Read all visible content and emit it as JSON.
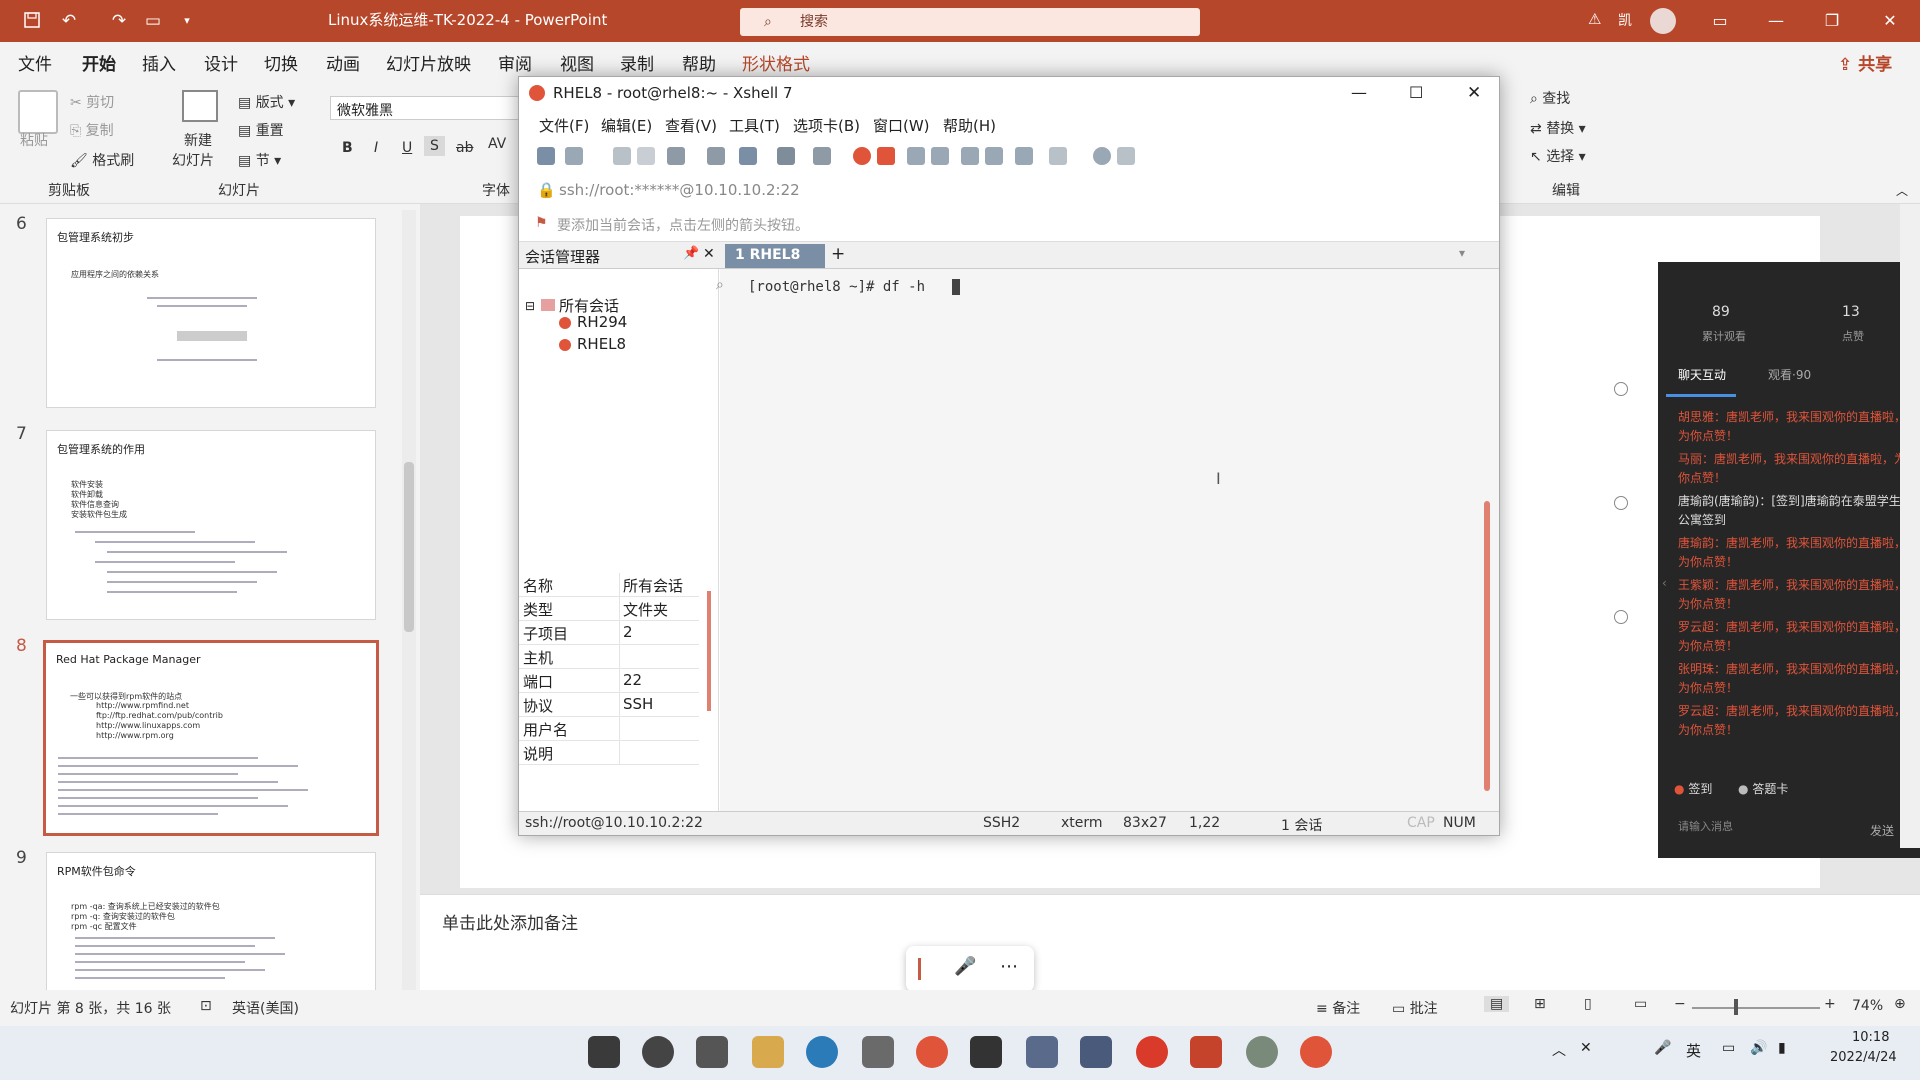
{
  "titlebar": {
    "doc_title": "Linux系统运维-TK-2022-4  -  PowerPoint",
    "search_placeholder": "搜索",
    "user_short": "凯"
  },
  "menu": [
    "文件",
    "开始",
    "插入",
    "设计",
    "切换",
    "动画",
    "幻灯片放映",
    "审阅",
    "视图",
    "录制",
    "帮助",
    "形状格式"
  ],
  "share_label": "共享",
  "ribbon": {
    "paste": "粘贴",
    "cut": "剪切",
    "copy": "复制",
    "format_painter": "格式刷",
    "clipboard": "剪贴板",
    "new_slide_1": "新建",
    "new_slide_2": "幻灯片",
    "layout": "版式",
    "reset": "重置",
    "section": "节",
    "slides_group": "幻灯片",
    "font_name": "微软雅黑",
    "font_group": "字体",
    "bold": "B",
    "italic": "I",
    "underline": "U",
    "shadow": "S",
    "strike": "ab",
    "spacing": "AV",
    "find": "查找",
    "replace": "替换",
    "select": "选择",
    "edit_group": "编辑"
  },
  "slides": [
    {
      "num": "6",
      "title": "包管理系统初步",
      "sub": [
        "应用程序之间的依赖关系"
      ]
    },
    {
      "num": "7",
      "title": "包管理系统的作用",
      "sub": [
        "软件安装",
        "软件卸载",
        "软件信息查询",
        "安装软件包生成"
      ]
    },
    {
      "num": "8",
      "title": "Red Hat Package Manager",
      "sub": [
        "一些可以获得到rpm软件的站点",
        "http://www.rpmfind.net",
        "ftp://ftp.redhat.com/pub/contrib",
        "http://www.linuxapps.com",
        "http://www.rpm.org"
      ]
    },
    {
      "num": "9",
      "title": "RPM软件包命令",
      "sub": [
        "rpm -qa: 查询系统上已经安装过的软件包",
        "rpm -q: 查询安装过的软件包",
        "rpm -qc 配置文件"
      ]
    }
  ],
  "notes_placeholder": "单击此处添加备注",
  "statusbar": {
    "slide_info": "幻灯片 第 8 张，共 16 张",
    "language": "英语(美国)",
    "notes": "备注",
    "comments": "批注",
    "zoom": "74%"
  },
  "xshell": {
    "title": "RHEL8 - root@rhel8:~ - Xshell 7",
    "menu": [
      "文件(F)",
      "编辑(E)",
      "查看(V)",
      "工具(T)",
      "选项卡(B)",
      "窗口(W)",
      "帮助(H)"
    ],
    "address": "ssh://root:******@10.10.10.2:22",
    "hint": "要添加当前会话，点击左侧的箭头按钮。",
    "session_manager": "会话管理器",
    "tab_label": "1 RHEL8",
    "tree_root": "所有会话",
    "tree_items": [
      "RH294",
      "RHEL8"
    ],
    "terminal_line": "[root@rhel8 ~]# df -h",
    "props": [
      {
        "k": "名称",
        "v": "所有会话"
      },
      {
        "k": "类型",
        "v": "文件夹"
      },
      {
        "k": "子项目",
        "v": "2"
      },
      {
        "k": "主机",
        "v": ""
      },
      {
        "k": "端口",
        "v": "22"
      },
      {
        "k": "协议",
        "v": "SSH"
      },
      {
        "k": "用户名",
        "v": ""
      },
      {
        "k": "说明",
        "v": ""
      }
    ],
    "status": {
      "conn": "ssh://root@10.10.10.2:22",
      "proto": "SSH2",
      "term": "xterm",
      "size": "83x27",
      "pos": "1,22",
      "sessions": "1 会话",
      "cap": "CAP",
      "num": "NUM"
    }
  },
  "live": {
    "stat1_value": "89",
    "stat1_label": "累计观看",
    "stat2_value": "13",
    "stat2_label": "点赞",
    "tab_chat": "聊天互动",
    "tab_watch": "观看·90",
    "messages": [
      "胡思雅：唐凯老师，我来围观你的直播啦，为你点赞！",
      "马丽：唐凯老师，我来围观你的直播啦，为你点赞！",
      "唐瑜韵(唐瑜韵)：[签到]唐瑜韵在泰盟学生公寓签到",
      "唐瑜韵：唐凯老师，我来围观你的直播啦，为你点赞！",
      "王紫颖：唐凯老师，我来围观你的直播啦，为你点赞！",
      "罗云超：唐凯老师，我来围观你的直播啦，为你点赞！",
      "张明珠：唐凯老师，我来围观你的直播啦，为你点赞！",
      "罗云超：唐凯老师，我来围观你的直播啦，为你点赞！"
    ],
    "checkin": "签到",
    "answer_card": "答题卡",
    "input_placeholder": "请输入消息",
    "send": "发送"
  },
  "taskbar": {
    "time": "10:18",
    "date": "2022/4/24",
    "ime": "英"
  },
  "colors": {
    "accent": "#b7472a",
    "live_msg": "#e0543a"
  }
}
